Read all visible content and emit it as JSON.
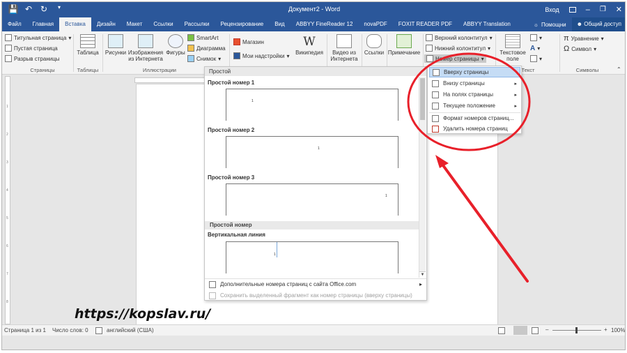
{
  "window": {
    "title": "Документ2 - Word",
    "login": "Вход"
  },
  "tabs": [
    "Файл",
    "Главная",
    "Вставка",
    "Дизайн",
    "Макет",
    "Ссылки",
    "Рассылки",
    "Рецензирование",
    "Вид",
    "ABBYY FineReader 12",
    "novaPDF",
    "FOXIT READER PDF",
    "ABBYY Translation"
  ],
  "active_tab": "Вставка",
  "help": "Помощни",
  "share": "Общий доступ",
  "ribbon": {
    "pages": {
      "items": [
        "Титульная страница",
        "Пустая страница",
        "Разрыв страницы"
      ],
      "label": "Страницы"
    },
    "tables": {
      "button": "Таблица",
      "label": "Таблицы"
    },
    "illustrations": {
      "pictures": "Рисунки",
      "online_images": "Изображения из Интернета",
      "shapes": "Фигуры",
      "smartart": "SmartArt",
      "chart": "Диаграмма",
      "screenshot": "Снимок",
      "label": "Иллюстрации"
    },
    "addins": {
      "store": "Магазин",
      "my_addins": "Мои надстройки",
      "wikipedia": "Википедия"
    },
    "media": {
      "online_video": "Видео из Интернета"
    },
    "links": {
      "button": "Ссылки"
    },
    "comments": {
      "button": "Примечание"
    },
    "header_footer": {
      "header": "Верхний колонтитул",
      "footer": "Нижний колонтитул",
      "page_number": "Номер страницы"
    },
    "text": {
      "textbox": "Текстовое поле",
      "label": "Текст"
    },
    "symbols": {
      "equation": "Уравнение",
      "symbol": "Символ",
      "label": "Символы"
    }
  },
  "gallery": {
    "header": "Простой",
    "items": [
      {
        "label": "Простой номер 1",
        "num": "1"
      },
      {
        "label": "Простой номер 2",
        "num": "1"
      },
      {
        "label": "Простой номер 3",
        "num": "1"
      }
    ],
    "section2": "Простой номер",
    "vertical": {
      "label": "Вертикальная линия",
      "num": "1"
    },
    "more": "Дополнительные номера страниц с сайта Office.com",
    "save": "Сохранить выделенный фрагмент как номер страницы (вверху страницы)"
  },
  "submenu": {
    "items": [
      "Вверху страницы",
      "Внизу страницы",
      "На полях страницы",
      "Текущее положение"
    ],
    "format": "Формат номеров страниц...",
    "remove": "Удалить номера страниц"
  },
  "status": {
    "page": "Страница 1 из 1",
    "words": "Число слов: 0",
    "language": "английский (США)",
    "zoom": "100%"
  },
  "watermark": "https://kopslav.ru/",
  "colors": {
    "word_blue": "#2b579a",
    "highlight": "#c5dcf5",
    "annotation_red": "#e8202a"
  }
}
